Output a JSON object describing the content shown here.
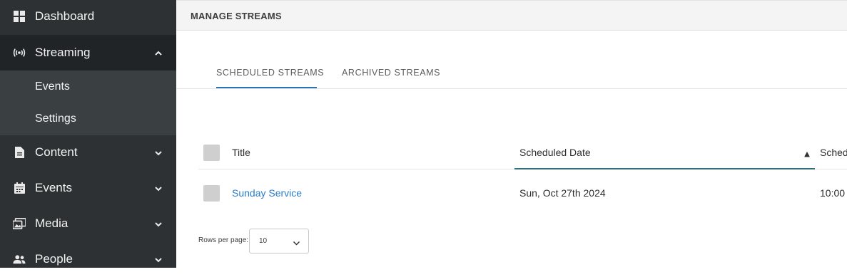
{
  "sidebar": {
    "items": [
      {
        "label": "Dashboard",
        "icon": "grid-icon"
      },
      {
        "label": "Streaming",
        "icon": "broadcast-icon",
        "expanded": true,
        "children": [
          {
            "label": "Events"
          },
          {
            "label": "Settings"
          }
        ]
      },
      {
        "label": "Content",
        "icon": "document-icon"
      },
      {
        "label": "Events",
        "icon": "calendar-icon"
      },
      {
        "label": "Media",
        "icon": "media-icon"
      },
      {
        "label": "People",
        "icon": "people-icon"
      }
    ]
  },
  "header": {
    "title": "MANAGE STREAMS"
  },
  "tabs": [
    {
      "label": "SCHEDULED STREAMS",
      "active": true
    },
    {
      "label": "ARCHIVED STREAMS",
      "active": false
    }
  ],
  "table": {
    "columns": [
      "Title",
      "Scheduled Date",
      "Sched"
    ],
    "sorted_column": "Scheduled Date",
    "rows": [
      {
        "title": "Sunday Service",
        "date": "Sun, Oct 27th 2024",
        "time": "10:00"
      }
    ]
  },
  "pagination": {
    "rows_per_page_label": "Rows per page:",
    "rows_per_page": "10"
  },
  "colors": {
    "sidebar_bg": "#2d3133",
    "accent": "#2a75b0",
    "link": "#2a7cc8"
  }
}
